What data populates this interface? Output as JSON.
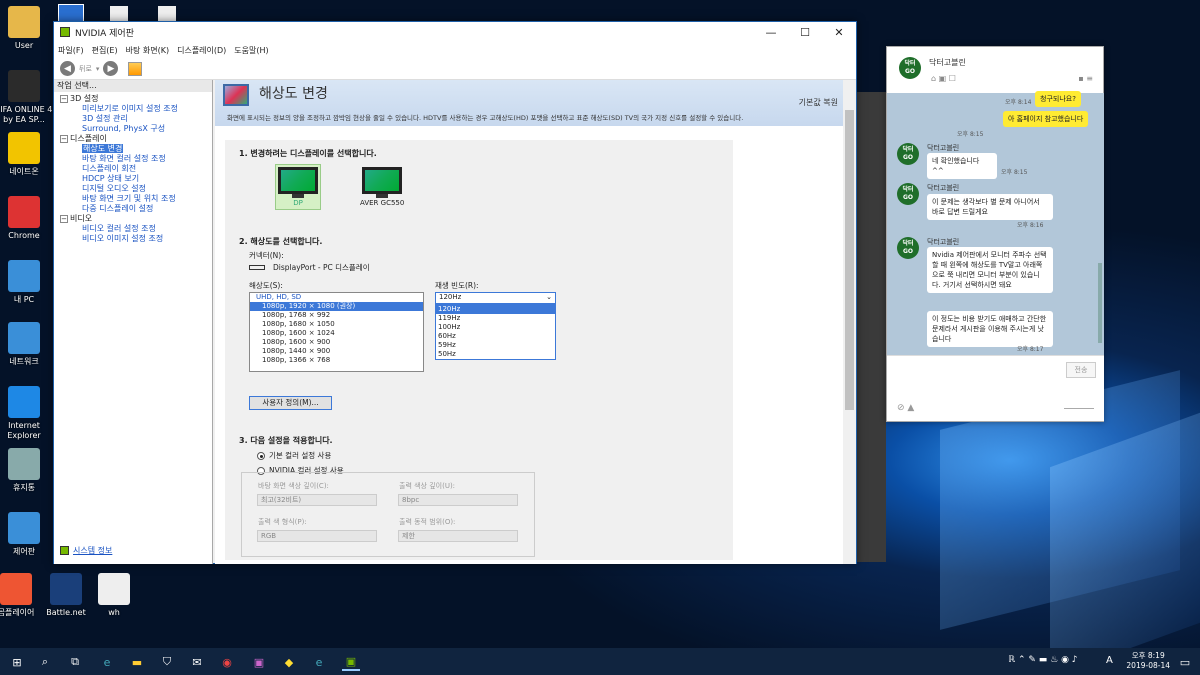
{
  "desktop": {
    "icons": [
      {
        "label": "User",
        "icon": "folder-icon",
        "color": "#e6b74a"
      },
      {
        "label": "FIFA ONLINE 4 by EA SP...",
        "icon": "fifa-icon",
        "color": "#2b2b2b"
      },
      {
        "label": "네이트온",
        "icon": "nateon-icon",
        "color": "#f2c400"
      },
      {
        "label": "Chrome",
        "icon": "chrome-icon",
        "color": "#d33"
      },
      {
        "label": "내 PC",
        "icon": "pc-icon",
        "color": "#3a8fd8"
      },
      {
        "label": "네트워크",
        "icon": "network-icon",
        "color": "#3a8fd8"
      },
      {
        "label": "Internet Explorer",
        "icon": "ie-icon",
        "color": "#1e88e5"
      },
      {
        "label": "휴지통",
        "icon": "recycle-bin-icon",
        "color": "#8aa"
      },
      {
        "label": "제어판",
        "icon": "control-panel-icon",
        "color": "#3a8fd8"
      },
      {
        "label": "곰플레이어",
        "icon": "gomplayer-icon",
        "color": "#e53"
      },
      {
        "label": "Battle.net",
        "icon": "battlenet-icon",
        "color": "#1a3f7a"
      },
      {
        "label": "wh",
        "icon": "file-icon",
        "color": "#eee"
      }
    ]
  },
  "nvidia": {
    "title": "NVIDIA 제어판",
    "controls": {
      "min": "—",
      "max": "☐",
      "close": "✕"
    },
    "menu": [
      "파일(F)",
      "편집(E)",
      "바탕 화면(K)",
      "디스플레이(D)",
      "도움말(H)"
    ],
    "back_label": "뒤로",
    "task_header": "작업 선택...",
    "tree": {
      "cat1": "3D 설정",
      "cat1_items": [
        "미리보기로 이미지 설정 조정",
        "3D 설정 관리",
        "Surround, PhysX 구성"
      ],
      "cat2": "디스플레이",
      "cat2_items": [
        "해상도 변경",
        "바탕 화면 컬러 설정 조정",
        "디스플레이 회전",
        "HDCP 상태 보기",
        "디지털 오디오 설정",
        "바탕 화면 크기 및 위치 조정",
        "다중 디스플레이 설정"
      ],
      "cat3": "비디오",
      "cat3_items": [
        "비디오 컬러 설정 조정",
        "비디오 이미지 설정 조정"
      ]
    },
    "system_info": "시스템 정보",
    "page_title": "해상도 변경",
    "restore": "기본값 복원",
    "description": "화면에 표시되는 정보의 양을 조정하고 깜박임 현상을 줄일 수 있습니다. HDTV를 사용하는 경우 고해상도(HD) 포맷을 선택하고 표준 해상도(SD) TV의 국가 지정 신호를 설정할 수 있습니다.",
    "step1": "1. 변경하려는 디스플레이를 선택합니다.",
    "displays": [
      "DP",
      "AVER GC550"
    ],
    "step2": "2. 해상도를 선택합니다.",
    "connector_label": "커넥터(N):",
    "connector_value": "DisplayPort - PC 디스플레이",
    "resolution_label": "해상도(S):",
    "resolution_group": "UHD, HD, SD",
    "resolutions": [
      "1080p, 1920 × 1080 (권장)",
      "1080p, 1768 × 992",
      "1080p, 1680 × 1050",
      "1080p, 1600 × 1024",
      "1080p, 1600 × 900",
      "1080p, 1440 × 900",
      "1080p, 1366 × 768"
    ],
    "refresh_label": "재생 빈도(R):",
    "refresh_selected": "120Hz",
    "refresh_options": [
      "120Hz",
      "119Hz",
      "100Hz",
      "60Hz",
      "59Hz",
      "50Hz"
    ],
    "custom_button": "사용자 정의(M)...",
    "step3": "3. 다음 설정을 적용합니다.",
    "radio_default": "기본 컬러 설정 사용",
    "radio_nvidia": "NVIDIA 컬러 설정 사용",
    "desktop_depth_label": "바탕 화면 색상 깊이(C):",
    "desktop_depth_value": "최고(32비트)",
    "output_depth_label": "출력 색상 깊이(U):",
    "output_depth_value": "8bpc",
    "output_format_label": "출력 색 형식(P):",
    "output_format_value": "RGB",
    "output_range_label": "출력 동적 범위(O):",
    "output_range_value": "제한"
  },
  "chat": {
    "name": "닥터고블린",
    "logo_text": "닥터 GO",
    "messages": [
      {
        "who": "me",
        "text": "청구되나요?",
        "time": "오후 8:14"
      },
      {
        "who": "me",
        "text": "아 홈페이지 참고했습니다",
        "time": "오후 8:15"
      },
      {
        "who": "them",
        "sender": "닥터고블린",
        "text": "네 확인했습니다 ^^",
        "time": "오후 8:15"
      },
      {
        "who": "them",
        "sender": "닥터고블린",
        "text": "이 문제는 생각보다 별 문제 아니어서 바로 답변 드릴게요",
        "time": "오후 8:16"
      },
      {
        "who": "them",
        "sender": "닥터고블린",
        "text": "Nvidia 제어판에서 모니터 주파수 선택할 때 왼쪽에 해상도를 TV말고 아래쪽으로 쭉 내리면 모니터 부분이 있습니다. 거기서 선택하시면 돼요",
        "time": ""
      },
      {
        "who": "them",
        "text": "이 정도는 비용 받기도 애매하고 간단한 문제라서 게시판을 이용해 주시는게 낫습니다",
        "time": "오후 8:17"
      }
    ],
    "send_label": "전송"
  },
  "taskbar": {
    "time": "오후 8:19",
    "date": "2019-08-14",
    "ime": "A"
  },
  "colors": {
    "accent": "#3c78d8",
    "nvidia_green": "#76b900",
    "chat_bg": "#b2c7d9",
    "chat_me": "#ffeb33",
    "taskbar": "#10243f"
  }
}
